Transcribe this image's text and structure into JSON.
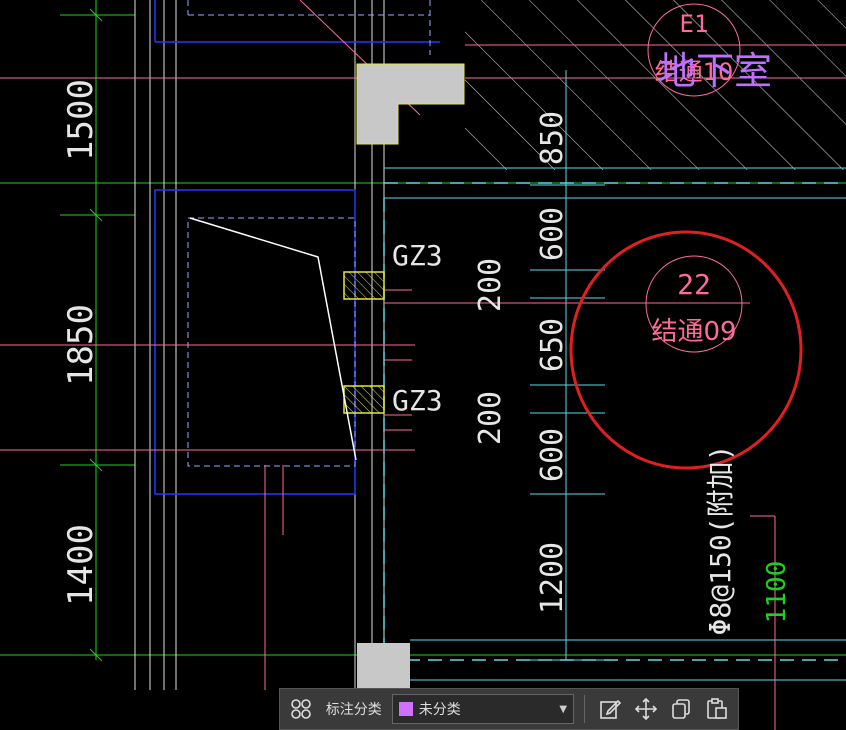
{
  "drawing": {
    "dims_left": [
      "1500",
      "1850",
      "1400"
    ],
    "gz_labels": [
      "GZ3",
      "GZ3"
    ],
    "dims_mid": [
      "200",
      "200"
    ],
    "dims_right": [
      "850",
      "600",
      "650",
      "600",
      "1200"
    ],
    "top_bubble": {
      "top": "E1",
      "bottom": "结通10"
    },
    "room_label": "地下室",
    "callout_bubble": {
      "top": "22",
      "bottom": "结通09"
    },
    "rebar_label": "Φ8@150(附加)",
    "dim_green": "1100"
  },
  "toolbar": {
    "grid_icon": "four-squares-icon",
    "annotation_label": "标注分类",
    "category_value": "未分类",
    "category_color": "#d070ff",
    "edit_icon": "edit-icon",
    "move_icon": "move-icon",
    "copy_icon": "copy-icon",
    "paste_icon": "paste-icon"
  },
  "colors": {
    "cyan": "#5fd7e6",
    "blue": "#2038ff",
    "green": "#20d020",
    "pink": "#ff6a9a",
    "white": "#ffffff",
    "yellow": "#e6e640",
    "gray_fill": "#c8c8c8",
    "magenta": "#c070ff",
    "red_circle": "#e02020"
  }
}
